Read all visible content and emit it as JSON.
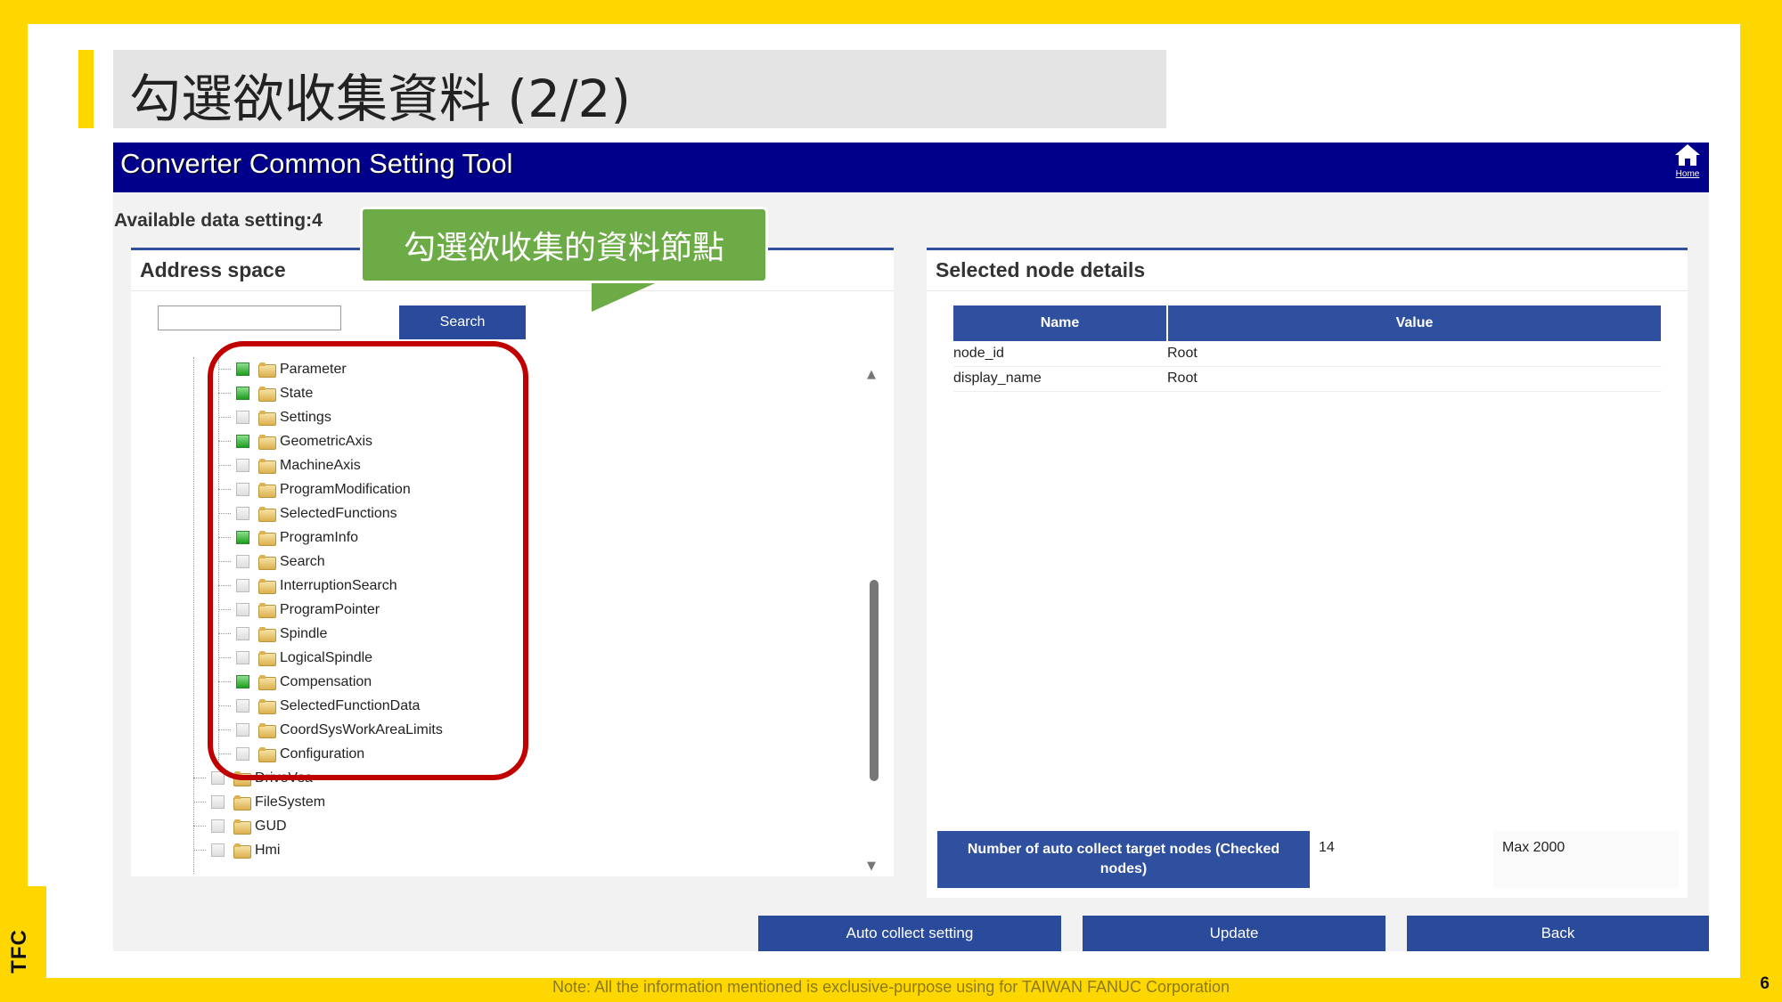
{
  "slide": {
    "title": "勾選欲收集資料 (2/2)",
    "footer_note": "Note: All the information mentioned is exclusive-purpose using for TAIWAN FANUC Corporation",
    "page_number": "6",
    "logo_text": "TFC"
  },
  "app": {
    "title": "Converter Common Setting Tool",
    "home_label": "Home",
    "available_label": "Available data setting:4"
  },
  "address_space": {
    "header": "Address space",
    "search_value": "",
    "search_button": "Search",
    "nodes": [
      {
        "label": "Parameter",
        "checked": true
      },
      {
        "label": "State",
        "checked": true
      },
      {
        "label": "Settings",
        "checked": false
      },
      {
        "label": "GeometricAxis",
        "checked": true
      },
      {
        "label": "MachineAxis",
        "checked": false
      },
      {
        "label": "ProgramModification",
        "checked": false
      },
      {
        "label": "SelectedFunctions",
        "checked": false
      },
      {
        "label": "ProgramInfo",
        "checked": true
      },
      {
        "label": "Search",
        "checked": false
      },
      {
        "label": "InterruptionSearch",
        "checked": false
      },
      {
        "label": "ProgramPointer",
        "checked": false
      },
      {
        "label": "Spindle",
        "checked": false
      },
      {
        "label": "LogicalSpindle",
        "checked": false
      },
      {
        "label": "Compensation",
        "checked": true
      },
      {
        "label": "SelectedFunctionData",
        "checked": false
      },
      {
        "label": "CoordSysWorkAreaLimits",
        "checked": false
      },
      {
        "label": "Configuration",
        "checked": false
      }
    ],
    "parent_nodes": [
      {
        "label": "DriveVsa",
        "checked": false
      },
      {
        "label": "FileSystem",
        "checked": false
      },
      {
        "label": "GUD",
        "checked": false
      },
      {
        "label": "Hmi",
        "checked": false
      }
    ]
  },
  "callout": {
    "text": "勾選欲收集的資料節點",
    "color": "#6cab45"
  },
  "details": {
    "header": "Selected node details",
    "col_name": "Name",
    "col_value": "Value",
    "rows": [
      {
        "name": "node_id",
        "value": "Root"
      },
      {
        "name": "display_name",
        "value": "Root"
      }
    ],
    "count_label": "Number of auto collect target nodes (Checked nodes)",
    "count_value": "14",
    "count_max": "Max 2000"
  },
  "actions": {
    "auto_collect": "Auto collect setting",
    "update": "Update",
    "back": "Back"
  },
  "colors": {
    "frame": "#ffd700",
    "header_bar": "#00008b",
    "button": "#2a4b9b",
    "highlight_ring": "#c00000"
  }
}
